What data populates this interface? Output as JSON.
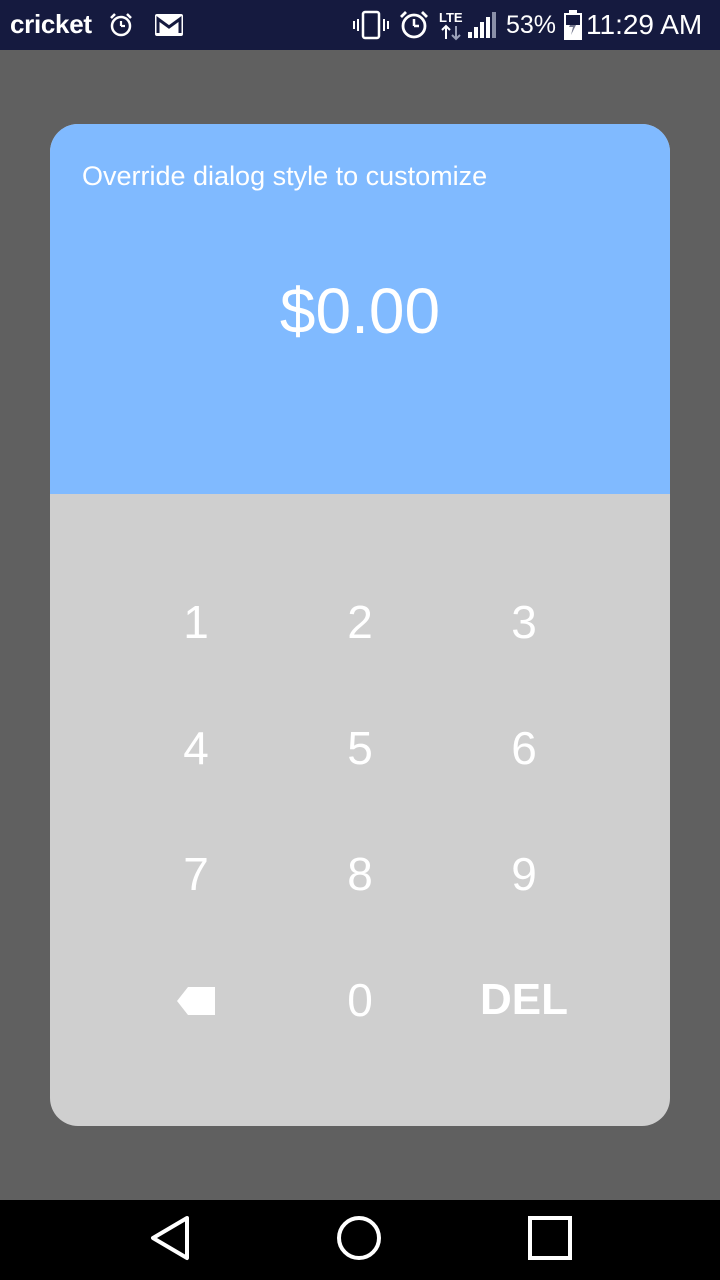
{
  "status_bar": {
    "carrier": "cricket",
    "battery_percent": "53%",
    "time": "11:29 AM",
    "network_type": "LTE",
    "icons": [
      "alarm-icon",
      "gmail-icon",
      "vibrate-icon",
      "alarm-icon",
      "lte-icon",
      "signal-icon",
      "battery-charging-icon"
    ]
  },
  "dialog": {
    "title": "Override dialog style to customize",
    "amount": "$0.00",
    "header_color": "#80baff",
    "body_color": "#cfcfcf"
  },
  "keypad": {
    "keys": [
      "1",
      "2",
      "3",
      "4",
      "5",
      "6",
      "7",
      "8",
      "9",
      "",
      "0",
      "DEL"
    ],
    "backspace_icon": "backspace-icon"
  },
  "nav_bar": {
    "icons": [
      "back-icon",
      "home-icon",
      "recents-icon"
    ]
  }
}
